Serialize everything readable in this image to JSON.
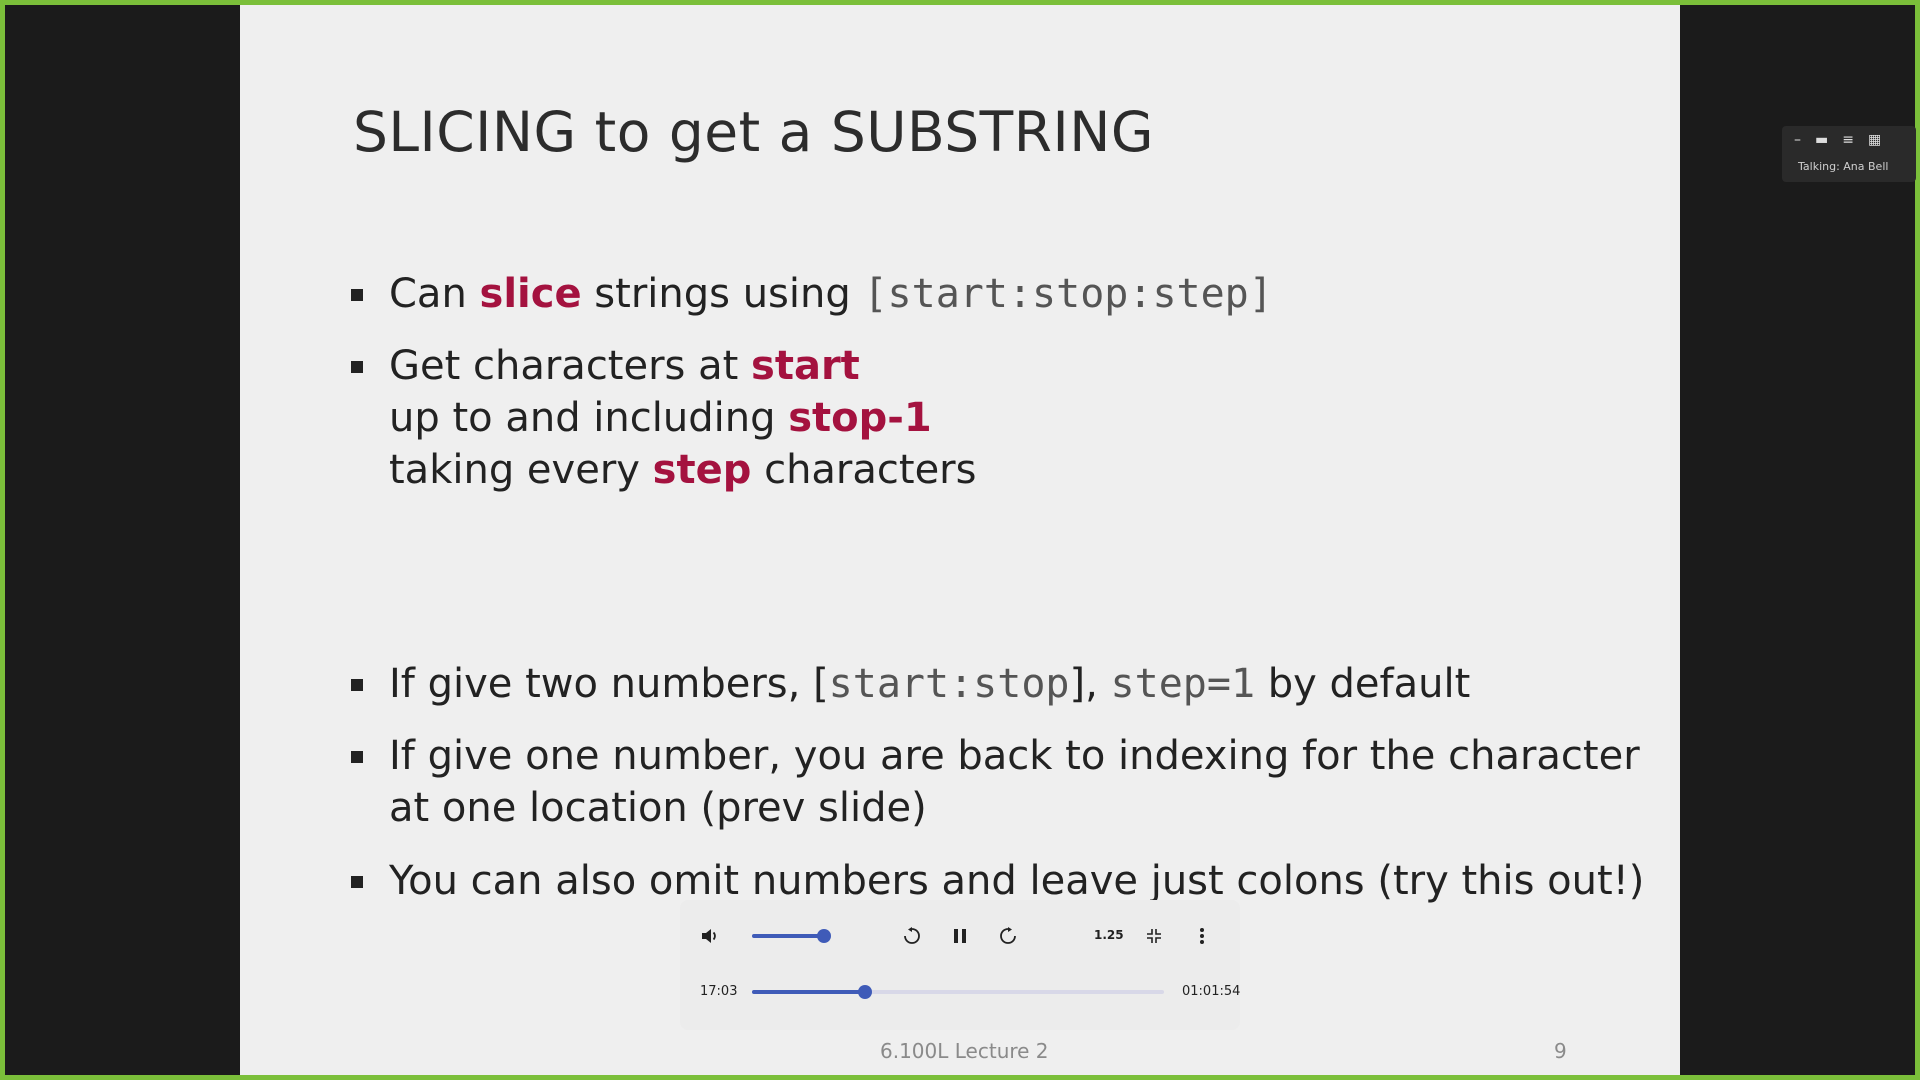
{
  "slide": {
    "title": "SLICING to get a SUBSTRING",
    "bullets": {
      "b1": {
        "p1": "Can ",
        "h1": "slice",
        "p2": " strings using ",
        "code": "[start:stop:step]"
      },
      "b2": {
        "l1_pre": "Get characters at ",
        "l1_hl": "start",
        "l2_pre": "up to and including ",
        "l2_hl": "stop-1",
        "l3_pre": "taking every ",
        "l3_hl": "step",
        "l3_post": " characters"
      },
      "b3": {
        "p1": "If give two numbers, [",
        "code1": "start:stop",
        "p2": "], ",
        "code2": "step=1",
        "p3": " by default"
      },
      "b4": {
        "l1": "If give one number, you are back to indexing for the character",
        "l2": "at one location (prev slide)"
      },
      "b5": {
        "text": "You can also omit numbers and leave just colons (try this out!)"
      }
    },
    "footer": "6.100L Lecture 2",
    "page_number": "9"
  },
  "player": {
    "volume_icon": "volume-icon",
    "rewind_icon": "rewind-icon",
    "pause_icon": "pause-icon",
    "forward_icon": "forward-icon",
    "speed": "1.25",
    "fullscreen_icon": "exit-fullscreen-icon",
    "more_icon": "more-vertical-icon",
    "current_time": "17:03",
    "duration": "01:01:54",
    "volume_level": 0.9,
    "progress_fraction": 0.275
  },
  "meeting": {
    "talking_label": "Talking: Ana Bell"
  },
  "colors": {
    "border": "#7bbf3a",
    "highlight": "#a4123f",
    "accent": "#3f5bb8"
  }
}
